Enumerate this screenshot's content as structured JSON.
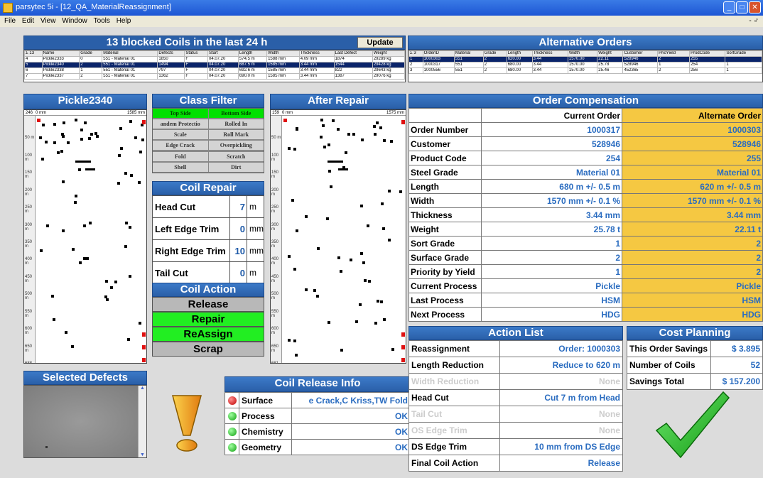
{
  "window": {
    "title": "parsytec 5i - [12_QA_MaterialReassignment]",
    "min": "_",
    "max": "□",
    "close": "✕"
  },
  "menu": [
    "File",
    "Edit",
    "View",
    "Window",
    "Tools",
    "Help"
  ],
  "menu_right": "- ♂",
  "blocked": {
    "title": "13 blocked Coils in the last 24 h",
    "update": "Update",
    "headers": [
      "Σ 13",
      "Name",
      "Grade",
      "Material",
      "Defects",
      "Status",
      "Start",
      "Length",
      "Width",
      "Thickness",
      "Last Defect",
      "Weight"
    ],
    "rows": [
      [
        "4",
        "Pickle2333",
        "0",
        "551 - Material 01",
        "1850",
        "F",
        "04.07.20",
        "574.5 m",
        "1588 mm",
        "4.09 mm",
        "1874",
        "29289 kg"
      ],
      [
        "5",
        "Pickle2340",
        "2",
        "551 - Material 01",
        "1494",
        "F",
        "04.07.20",
        "687.5 m",
        "1585 mm",
        "3.44 mm",
        "1544",
        "29428 kg"
      ],
      [
        "6",
        "Pickle2338",
        "1",
        "551 - Material 01",
        "797",
        "F",
        "04.07.20",
        "692.6 m",
        "1585 mm",
        "3.44 mm",
        "822",
        "29643 kg"
      ],
      [
        "7",
        "Pickle2337",
        "2",
        "551 - Material 01",
        "1362",
        "F",
        "04.07.20",
        "690.0 m",
        "1585 mm",
        "3.44 mm",
        "1387",
        "29076 kg"
      ]
    ]
  },
  "alt_orders": {
    "title": "Alternative Orders",
    "headers": [
      "Σ 3",
      "OrderID",
      "Material",
      "Grade",
      "Length",
      "Thickness",
      "Width",
      "Weight",
      "Customer",
      "PrioYield",
      "ProdCode",
      "SortGrade"
    ],
    "rows": [
      [
        "1",
        "1000303",
        "551",
        "2",
        "620.00",
        "3.44",
        "1570.00",
        "22.11",
        "528946",
        "2",
        "255",
        ""
      ],
      [
        "2",
        "1000317",
        "551",
        "2",
        "680.00",
        "3.44",
        "1570.00",
        "25.78",
        "528946",
        "1",
        "254",
        "1"
      ],
      [
        "3",
        "1000556",
        "551",
        "2",
        "680.00",
        "3.44",
        "1570.00",
        "25.46",
        "452365",
        "2",
        "256",
        "1"
      ]
    ]
  },
  "pickle": {
    "title": "Pickle2340",
    "hdr_left": "246",
    "hdr_mid": "0 mm",
    "hdr_right": "1585 mm",
    "ticks": [
      "50 m",
      "100 m",
      "150 m",
      "200 m",
      "250 m",
      "300 m",
      "350 m",
      "400 m",
      "450 m",
      "500 m",
      "550 m",
      "600 m",
      "650 m",
      "688 m"
    ]
  },
  "after": {
    "title": "After Repair",
    "hdr_left": "159",
    "hdr_mid": "0 mm",
    "hdr_right": "1575 mm",
    "ticks": [
      "50 m",
      "100 m",
      "150 m",
      "200 m",
      "250 m",
      "300 m",
      "350 m",
      "400 m",
      "450 m",
      "500 m",
      "550 m",
      "600 m",
      "650 m",
      "681 m"
    ]
  },
  "class_filter": {
    "title": "Class Filter",
    "items": [
      {
        "label": "Top Side",
        "on": true
      },
      {
        "label": "Bottom Side",
        "on": true
      },
      {
        "label": "andem Protectio",
        "on": false
      },
      {
        "label": "Rolled In",
        "on": false
      },
      {
        "label": "Scale",
        "on": false
      },
      {
        "label": "Roll Mark",
        "on": false
      },
      {
        "label": "Edge Crack",
        "on": false
      },
      {
        "label": "Overpickling",
        "on": false
      },
      {
        "label": "Fold",
        "on": false
      },
      {
        "label": "Scratch",
        "on": false
      },
      {
        "label": "Shell",
        "on": false
      },
      {
        "label": "Dirt",
        "on": false
      }
    ]
  },
  "coil_repair": {
    "title": "Coil Repair",
    "rows": [
      {
        "label": "Head Cut",
        "value": "7",
        "unit": "m"
      },
      {
        "label": "Left Edge Trim",
        "value": "0",
        "unit": "mm"
      },
      {
        "label": "Right Edge Trim",
        "value": "10",
        "unit": "mm"
      },
      {
        "label": "Tail Cut",
        "value": "0",
        "unit": "m"
      }
    ]
  },
  "coil_action": {
    "title": "Coil Action",
    "buttons": [
      {
        "label": "Release",
        "color": "#b8b8b8"
      },
      {
        "label": "Repair",
        "color": "#22ee22"
      },
      {
        "label": "ReAssign",
        "color": "#22ee22"
      },
      {
        "label": "Scrap",
        "color": "#b8b8b8"
      }
    ]
  },
  "selected_defects": {
    "title": "Selected Defects"
  },
  "coil_release": {
    "title": "Coil Release Info",
    "rows": [
      {
        "label": "Surface",
        "value": "e Crack,C Kriss,TW Fold",
        "status": "red"
      },
      {
        "label": "Process",
        "value": "OK",
        "status": "green"
      },
      {
        "label": "Chemistry",
        "value": "OK",
        "status": "green"
      },
      {
        "label": "Geometry",
        "value": "OK",
        "status": "green"
      }
    ]
  },
  "order_comp": {
    "title": "Order Compensation",
    "col_current": "Current Order",
    "col_alt": "Alternate Order",
    "rows": [
      [
        "Order Number",
        "1000317",
        "1000303"
      ],
      [
        "Customer",
        "528946",
        "528946"
      ],
      [
        "Product Code",
        "254",
        "255"
      ],
      [
        "Steel Grade",
        "Material 01",
        "Material 01"
      ],
      [
        "Length",
        "680 m +/- 0.5 m",
        "620 m +/- 0.5 m"
      ],
      [
        "Width",
        "1570 mm +/- 0.1 %",
        "1570 mm +/- 0.1 %"
      ],
      [
        "Thickness",
        "3.44 mm",
        "3.44 mm"
      ],
      [
        "Weight",
        "25.78 t",
        "22.11 t"
      ],
      [
        "Sort Grade",
        "1",
        "2"
      ],
      [
        "Surface Grade",
        "2",
        "2"
      ],
      [
        "Priority by Yield",
        "1",
        "2"
      ],
      [
        "Current Process",
        "Pickle",
        "Pickle"
      ],
      [
        "Last Process",
        "HSM",
        "HSM"
      ],
      [
        "Next Process",
        "HDG",
        "HDG"
      ]
    ]
  },
  "action_list": {
    "title": "Action List",
    "rows": [
      {
        "label": "Reassignment",
        "value": "Order: 1000303",
        "dim": false
      },
      {
        "label": "Length Reduction",
        "value": "Reduce to 620 m",
        "dim": false
      },
      {
        "label": "Width Reduction",
        "value": "None",
        "dim": true
      },
      {
        "label": "Head Cut",
        "value": "Cut 7 m from Head",
        "dim": false
      },
      {
        "label": "Tail Cut",
        "value": "None",
        "dim": true
      },
      {
        "label": "OS Edge Trim",
        "value": "None",
        "dim": true
      },
      {
        "label": "DS Edge Trim",
        "value": "10 mm from DS Edge",
        "dim": false
      },
      {
        "label": "Final Coil Action",
        "value": "Release",
        "dim": false
      }
    ]
  },
  "cost_planning": {
    "title": "Cost Planning",
    "rows": [
      {
        "label": "This Order Savings",
        "value": "$ 3.895"
      },
      {
        "label": "Number of Coils",
        "value": "52"
      },
      {
        "label": "Savings Total",
        "value": "$ 157.200"
      }
    ]
  },
  "colors": {
    "accent": "#2a5fa8",
    "green": "#22ee22",
    "yellow": "#f5c842",
    "check": "#22bb22",
    "warning": "#f0a020"
  }
}
